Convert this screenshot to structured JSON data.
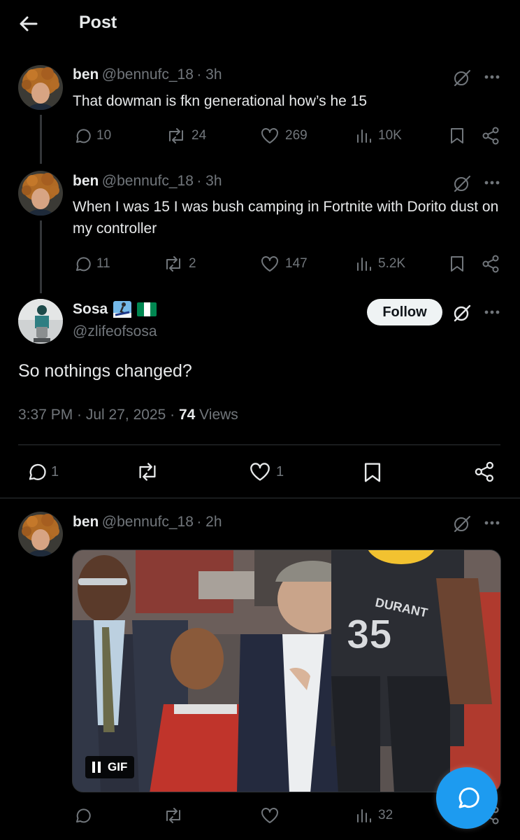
{
  "header": {
    "title": "Post"
  },
  "reply1": {
    "name": "ben",
    "handle": "@bennufc_18",
    "time": "· 3h",
    "text": "That dowman is fkn generational how’s he 15",
    "replies": "10",
    "reposts": "24",
    "likes": "269",
    "views": "10K"
  },
  "reply2": {
    "name": "ben",
    "handle": "@bennufc_18",
    "time": "· 3h",
    "text": "When I was 15 I was bush camping in Fortnite with Dorito dust on my controller",
    "replies": "11",
    "reposts": "2",
    "likes": "147",
    "views": "5.2K"
  },
  "main_post": {
    "name": "Sosa",
    "handle": "@zlifeofsosa",
    "follow_label": "Follow",
    "text": "So nothings changed?",
    "timestamp": "3:37 PM · Jul 27, 2025 ·",
    "views_count": "74",
    "views_label": "Views",
    "replies": "1",
    "likes": "1"
  },
  "reply3": {
    "name": "ben",
    "handle": "@bennufc_18",
    "time": "· 2h",
    "gif_label": "GIF",
    "jersey_name": "DURANT",
    "jersey_number": "35",
    "views": "32"
  },
  "colors": {
    "background": "#000000",
    "text": "#e7e9ea",
    "secondary": "#71767b",
    "accent": "#1d9bf0",
    "follow_bg": "#eff3f4"
  }
}
